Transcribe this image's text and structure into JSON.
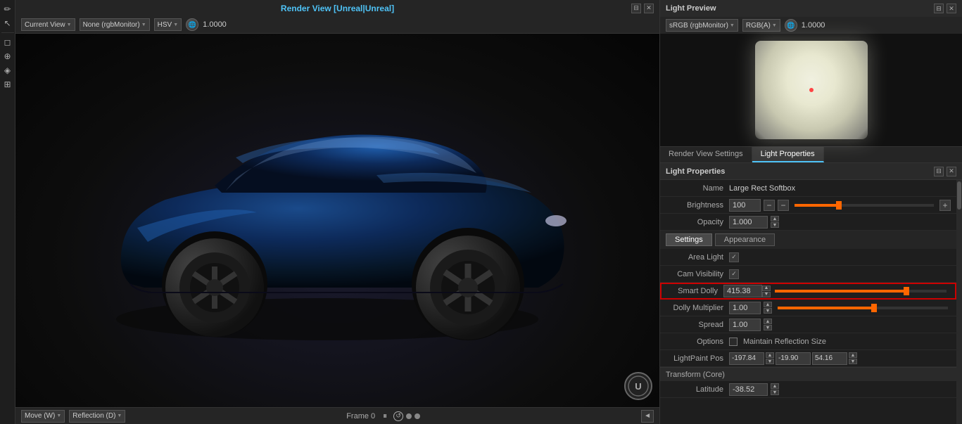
{
  "viewport": {
    "title": "Render View [Unreal|Unreal]",
    "view_label": "Current View",
    "color_profile": "None (rgbMonitor)",
    "color_mode": "HSV",
    "exposure": "1.0000",
    "frame_label": "Frame 0",
    "move_mode": "Move (W)",
    "reflection_mode": "Reflection (D)"
  },
  "light_preview": {
    "title": "Light Preview",
    "color_profile": "sRGB (rgbMonitor)",
    "channel": "RGB(A)",
    "exposure": "1.0000"
  },
  "tabs": {
    "render_view_settings": "Render View Settings",
    "light_properties": "Light Properties"
  },
  "light_properties_panel": {
    "title": "Light Properties",
    "name_label": "Name",
    "name_value": "Large Rect Softbox",
    "brightness_label": "Brightness",
    "brightness_value": "100",
    "opacity_label": "Opacity",
    "opacity_value": "1.000",
    "area_light_label": "Area Light",
    "cam_visibility_label": "Cam Visibility",
    "smart_dolly_label": "Smart Dolly",
    "smart_dolly_value": "415.38",
    "dolly_multiplier_label": "Dolly Multiplier",
    "dolly_multiplier_value": "1.00",
    "spread_label": "Spread",
    "spread_value": "1.00",
    "options_label": "Options",
    "maintain_reflection_label": "Maintain Reflection Size",
    "lightpaint_pos_label": "LightPaint Pos",
    "lightpaint_x": "-197.84",
    "lightpaint_y": "-19.90",
    "lightpaint_z": "54.16",
    "transform_label": "Transform (Core)",
    "latitude_label": "Latitude",
    "latitude_value": "-38.52"
  },
  "settings_tabs": {
    "settings": "Settings",
    "appearance": "Appearance"
  },
  "toolbar": {
    "move": "Move (W)",
    "reflection": "Reflection (D)"
  }
}
